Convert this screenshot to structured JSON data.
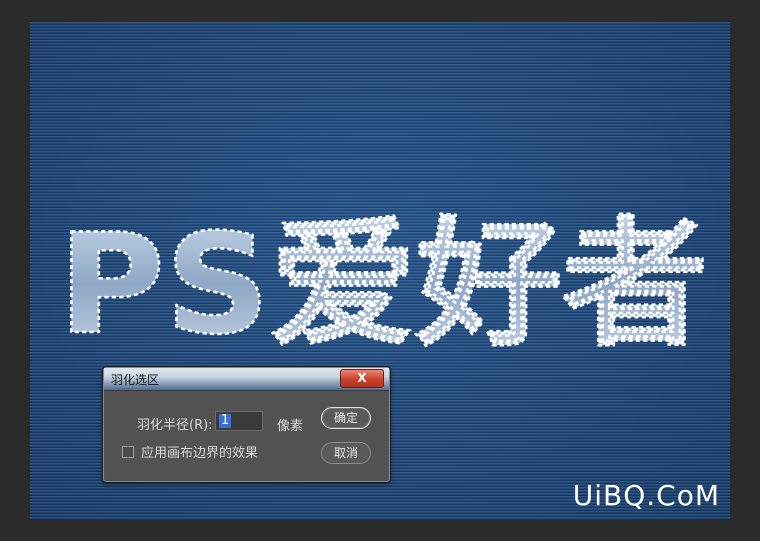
{
  "artwork": {
    "headline": "PS爱好者"
  },
  "watermark": "UiBQ.CoM",
  "dialog": {
    "title": "羽化选区",
    "close_label": "X",
    "radius_label": "羽化半径(R):",
    "radius_value": "1",
    "unit": "像素",
    "ok_label": "确定",
    "cancel_label": "取消",
    "checkbox_label": "应用画布边界的效果",
    "checkbox_checked": false
  }
}
